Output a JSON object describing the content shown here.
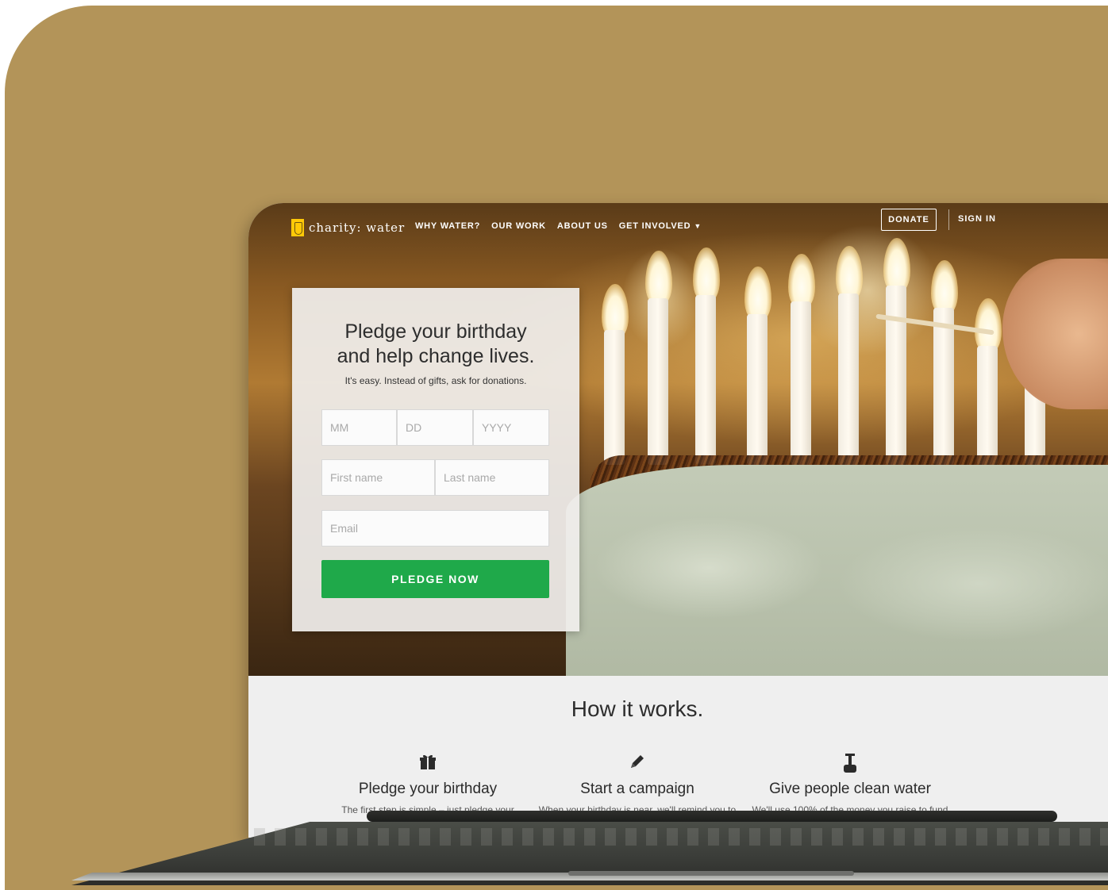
{
  "nav": {
    "logo_text": "charity: water",
    "links": [
      "WHY WATER?",
      "OUR WORK",
      "ABOUT US",
      "GET INVOLVED"
    ],
    "donate_label": "DONATE",
    "signin_label": "SIGN IN"
  },
  "form": {
    "title_line1": "Pledge your birthday",
    "title_line2": "and help change lives.",
    "subtitle": "It's easy. Instead of gifts, ask for donations.",
    "month_placeholder": "MM",
    "day_placeholder": "DD",
    "year_placeholder": "YYYY",
    "first_name_placeholder": "First name",
    "last_name_placeholder": "Last name",
    "email_placeholder": "Email",
    "submit_label": "PLEDGE NOW"
  },
  "how": {
    "title": "How it works.",
    "steps": [
      {
        "icon": "gift-icon",
        "title": "Pledge your birthday",
        "text": "The first step is simple – just pledge your"
      },
      {
        "icon": "pencil-icon",
        "title": "Start a campaign",
        "text": "When your birthday is near, we'll remind you to"
      },
      {
        "icon": "water-pump-icon",
        "title": "Give people clean water",
        "text": "We'll use 100% of the money you raise to fund"
      }
    ]
  },
  "colors": {
    "backdrop": "#b39459",
    "accent_green": "#1fa94a",
    "logo_yellow": "#ffc907"
  }
}
